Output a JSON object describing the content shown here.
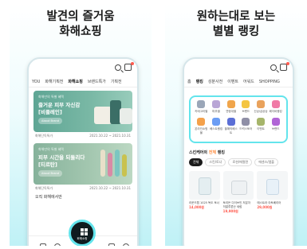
{
  "left": {
    "headline_line1": "발견의 즐거움",
    "headline_line2": "화해쇼핑",
    "tabs": [
      "YOU",
      "화해기획전",
      "화해쇼핑",
      "브랜드특가",
      "기획전"
    ],
    "banners": [
      {
        "small": "화해만의 특별 혜택",
        "line1": "즐거운 피부 자신감",
        "line2": "[비플레인]",
        "button": "About Brand",
        "meta_left": "화해단독특가",
        "meta_right": "2021.10.22 ~ 2021.10.31"
      },
      {
        "small": "화해만의 특별 혜택",
        "line1": "피부 시간을 되돌리다",
        "line2": "[티르탄]",
        "button": "About Brand",
        "meta_left": "화해단독특가",
        "meta_right": "2021.10.22 ~ 2021.10.31"
      }
    ],
    "bottom_text": "오직 화해에서만",
    "home_label": "화해쇼핑"
  },
  "right": {
    "headline_line1": "원하는대로 보는",
    "headline_line2": "별별 랭킹",
    "tabs": [
      "홈",
      "랭킹",
      "성분사전",
      "이벤트",
      "어워드",
      "SHOPPING"
    ],
    "categories": [
      {
        "label": "카테고리별",
        "color": "#9aa6b8"
      },
      {
        "label": "피부별",
        "color": "#b9a6d6"
      },
      {
        "label": "연령대별",
        "color": "#f0a54b"
      },
      {
        "label": "브랜드",
        "color": "#f4c542"
      },
      {
        "label": "신상/급상승",
        "color": "#e9a25c"
      },
      {
        "label": "베이비랭킹",
        "color": "#f07aa6"
      },
      {
        "label": "온라인쇼핑몰",
        "color": "#f4a14b"
      },
      {
        "label": "베스트랭킹",
        "color": "#6b9df4"
      },
      {
        "label": "올해의베스트",
        "color": "#5b6fd6"
      },
      {
        "label": "드럭스토어",
        "color": "#8f8fa6"
      },
      {
        "label": "이벤트",
        "color": "#a6b56b"
      },
      {
        "label": "브랜드",
        "color": "#b065d6"
      }
    ],
    "rank_title_prefix": "스킨케어의",
    "rank_title_accent": "전체",
    "rank_title_suffix": "랭킹",
    "chips": [
      "전체",
      "스킨/토너",
      "로션/에멀젼",
      "에센스/앰플"
    ],
    "products": [
      {
        "name": "라운드랩 1025 독도 토너",
        "price": "14,000원"
      },
      {
        "name": "토리든 다이브인 저분자 히알루론산 세럼",
        "price": "19,900원"
      },
      {
        "name": "에스트라 아토베리어",
        "price": "29,000원"
      }
    ]
  }
}
